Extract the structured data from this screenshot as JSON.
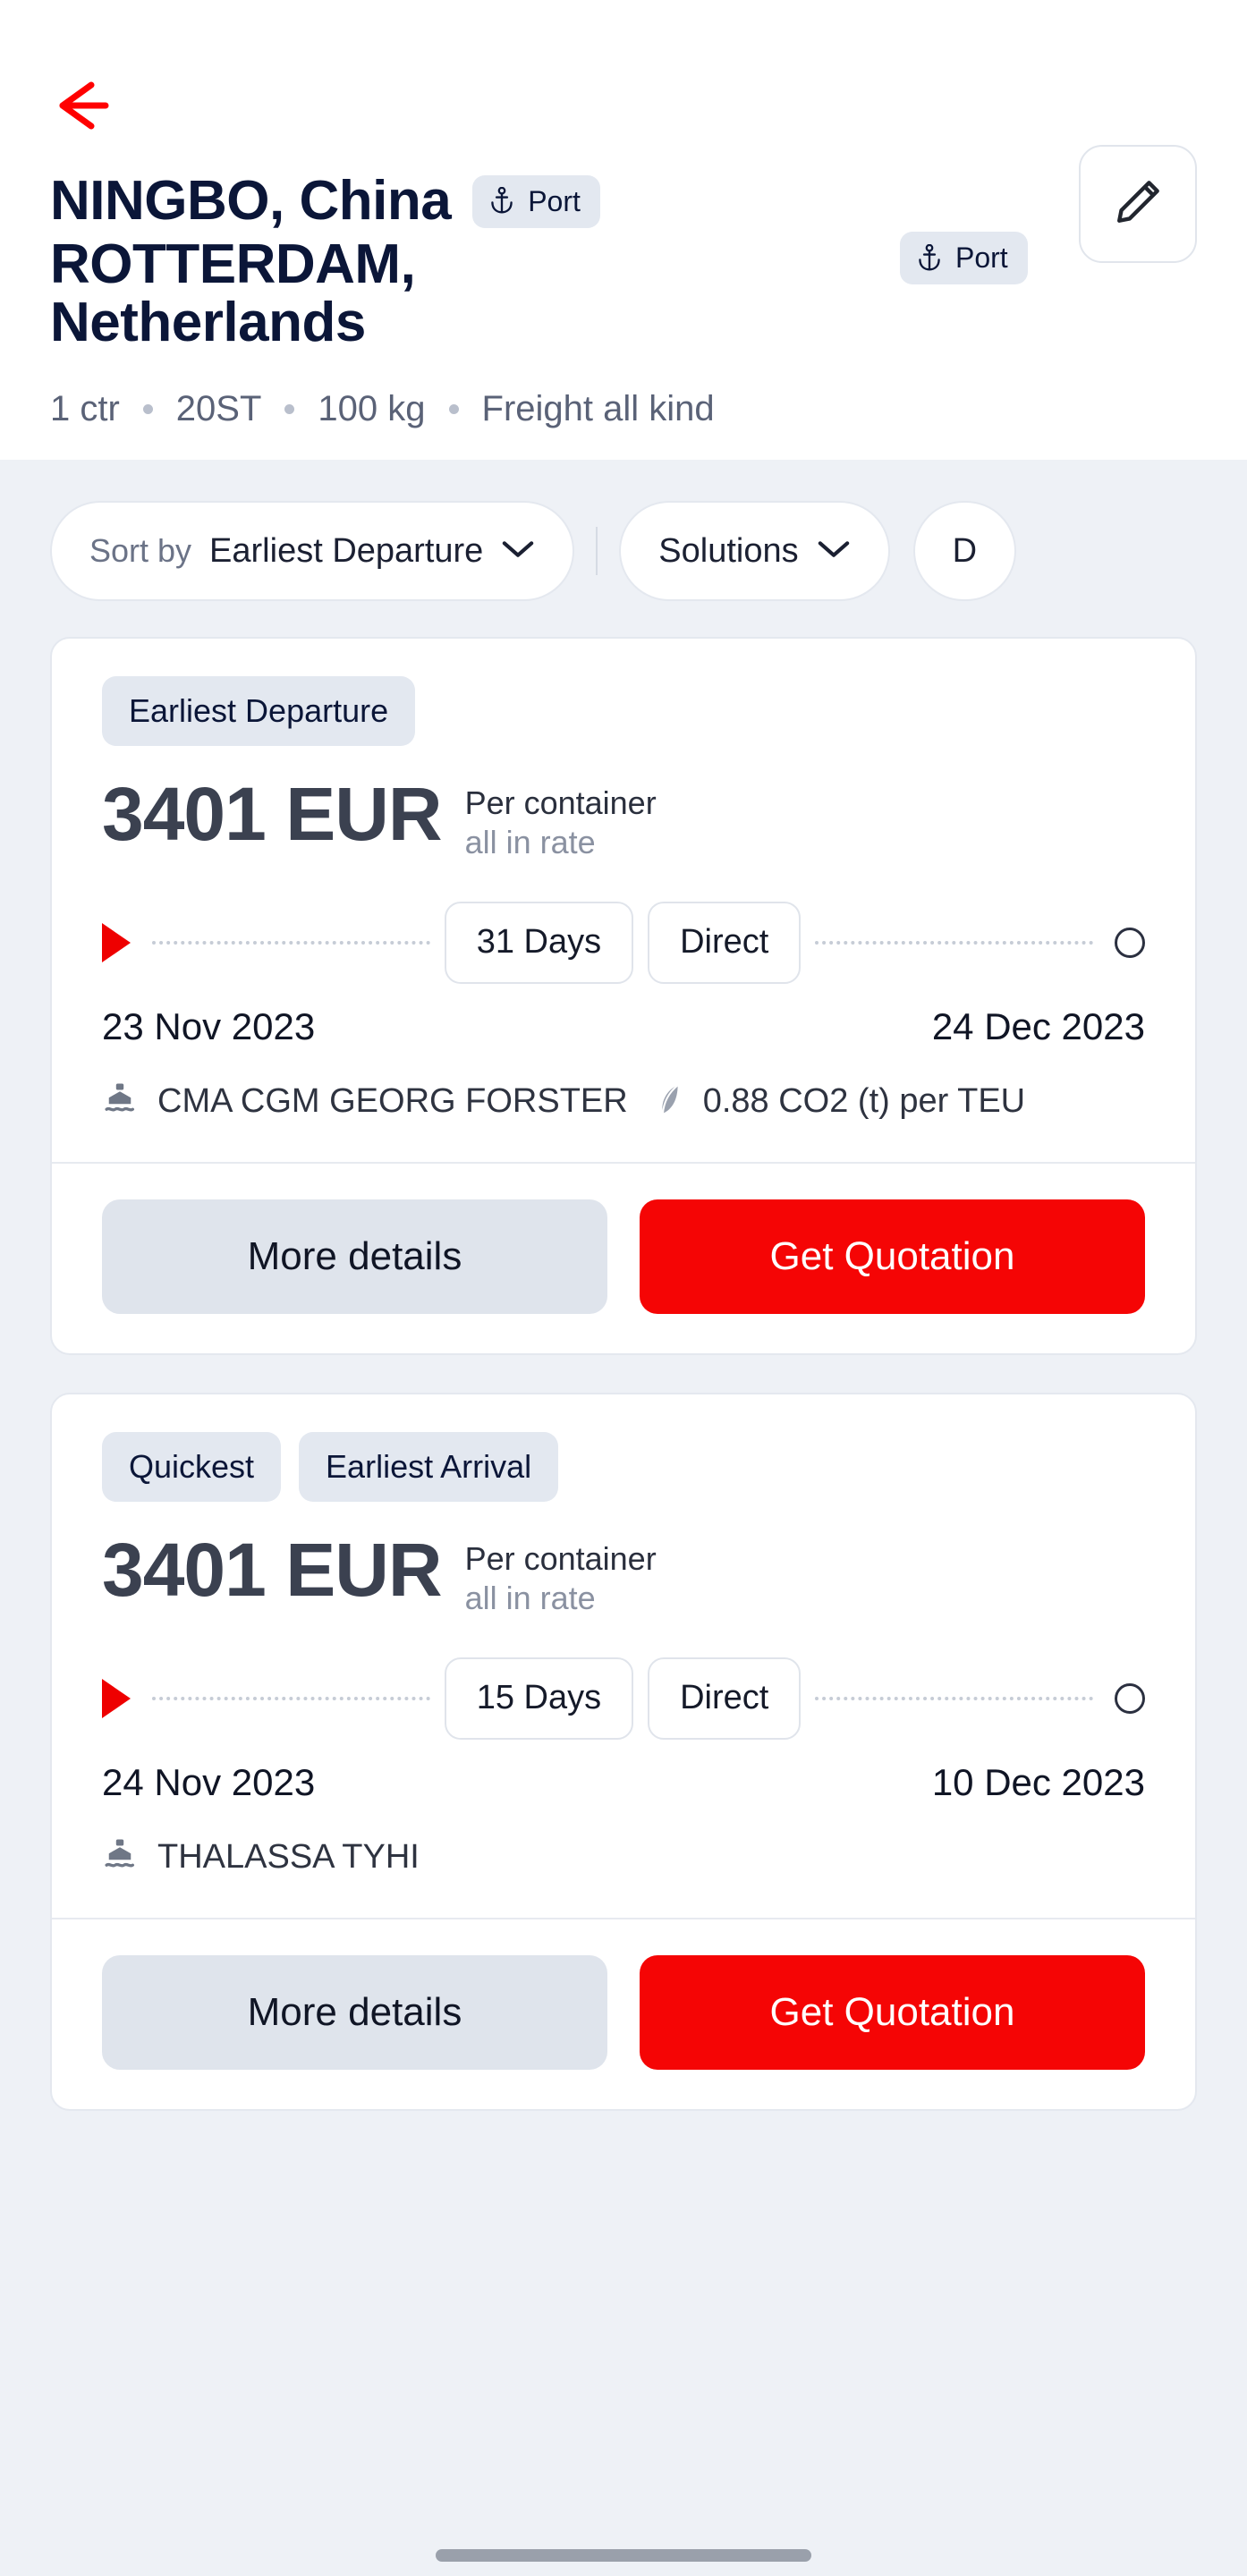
{
  "header": {
    "back_icon": "arrow-left-icon",
    "origin": "NINGBO, China",
    "destination_line1": "ROTTERDAM,",
    "destination_line2": "Netherlands",
    "origin_badge": {
      "icon": "anchor-icon",
      "label": "Port"
    },
    "destination_badge": {
      "icon": "anchor-icon",
      "label": "Port"
    },
    "edit_icon": "pencil-icon",
    "meta": {
      "containers": "1 ctr",
      "container_type": "20ST",
      "weight": "100 kg",
      "commodity": "Freight all kind"
    }
  },
  "filters": {
    "sort": {
      "prefix": "Sort by",
      "value": "Earliest Departure",
      "chevron": "chevron-down-icon"
    },
    "solutions": {
      "label": "Solutions",
      "chevron": "chevron-down-icon"
    },
    "third": {
      "label": "D"
    }
  },
  "results": [
    {
      "tags": [
        "Earliest Departure"
      ],
      "price": "3401 EUR",
      "price_sub1": "Per container",
      "price_sub2": "all in rate",
      "transit": "31 Days",
      "routing": "Direct",
      "departure_date": "23 Nov 2023",
      "arrival_date": "24 Dec 2023",
      "vessel": "CMA CGM GEORG FORSTER",
      "co2": "0.88 CO2 (t) per TEU",
      "more_details_label": "More details",
      "quotation_label": "Get Quotation"
    },
    {
      "tags": [
        "Quickest",
        "Earliest Arrival"
      ],
      "price": "3401 EUR",
      "price_sub1": "Per container",
      "price_sub2": "all in rate",
      "transit": "15 Days",
      "routing": "Direct",
      "departure_date": "24 Nov 2023",
      "arrival_date": "10 Dec 2023",
      "vessel": "THALASSA TYHI",
      "co2": "",
      "more_details_label": "More details",
      "quotation_label": "Get Quotation"
    }
  ],
  "colors": {
    "brand_red": "#f50505",
    "title_navy": "#0b1638",
    "badge_bg": "#e3e8f0",
    "page_bg": "#eef1f6"
  }
}
